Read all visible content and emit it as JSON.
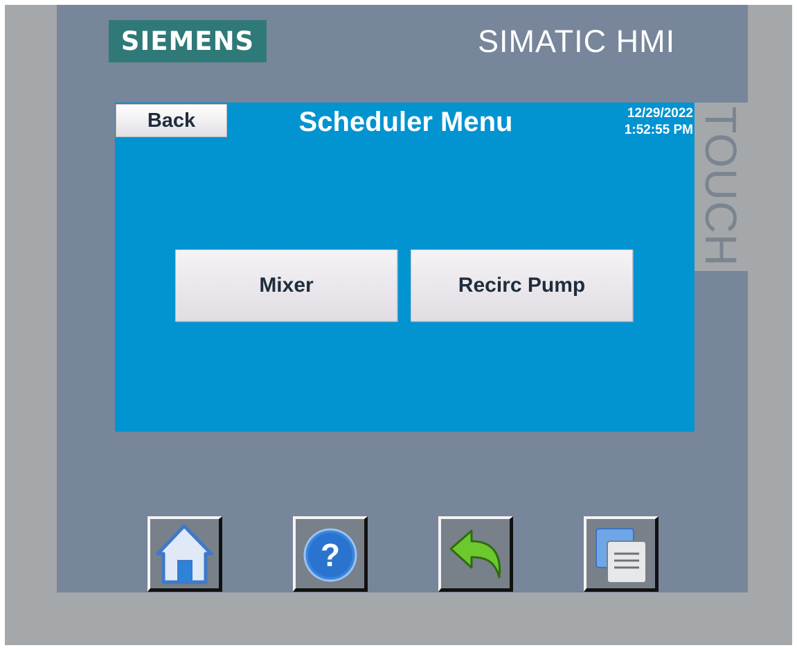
{
  "device": {
    "brand_logo": "SIEMENS",
    "model": "SIMATIC HMI",
    "side_label": "TOUCH"
  },
  "screen": {
    "back_label": "Back",
    "title": "Scheduler Menu",
    "date": "12/29/2022",
    "time": "1:52:55 PM",
    "buttons": [
      {
        "label": "Mixer"
      },
      {
        "label": "Recirc Pump"
      }
    ]
  },
  "function_keys": [
    {
      "icon": "home-icon"
    },
    {
      "icon": "help-icon"
    },
    {
      "icon": "undo-arrow-icon"
    },
    {
      "icon": "window-switch-icon"
    }
  ],
  "colors": {
    "screen_bg": "#0293d1",
    "bezel": "#77869a",
    "logo_bg": "#2f7a78"
  }
}
